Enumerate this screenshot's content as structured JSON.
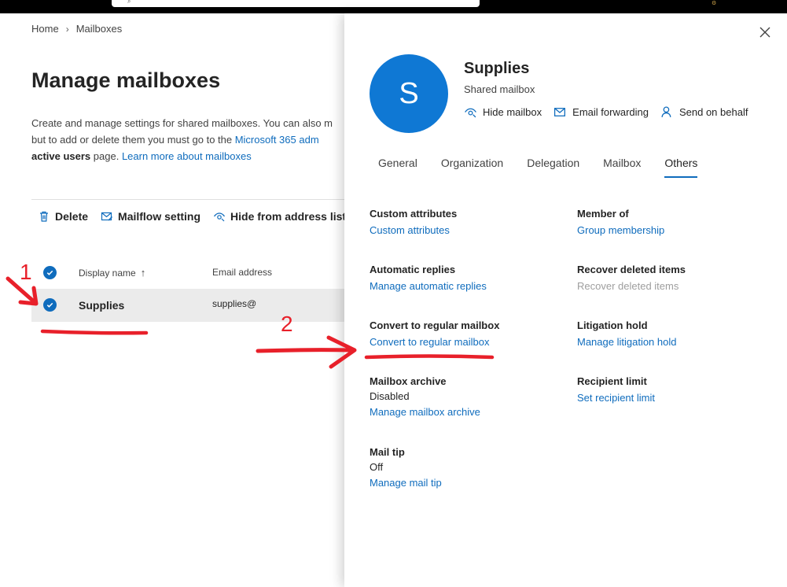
{
  "breadcrumb": {
    "home": "Home",
    "current": "Mailboxes"
  },
  "page": {
    "title": "Manage mailboxes",
    "desc_line1": "Create and manage settings for shared mailboxes. You can also m",
    "desc_line2_prefix": "but to add or delete them you must go to the ",
    "desc_line2_link": "Microsoft 365 adm",
    "desc_line3_bold": "active users",
    "desc_line3_text": " page. ",
    "desc_line3_link": "Learn more about mailboxes"
  },
  "toolbar": {
    "delete": "Delete",
    "mailflow": "Mailflow setting",
    "hide": "Hide from address list"
  },
  "table": {
    "col_name": "Display name",
    "sort_arrow": "↑",
    "col_email": "Email address",
    "rows": [
      {
        "name": "Supplies",
        "email": "supplies@"
      }
    ]
  },
  "panel": {
    "avatar_letter": "S",
    "title": "Supplies",
    "subtitle": "Shared mailbox",
    "actions": {
      "hide": "Hide mailbox",
      "forwarding": "Email forwarding",
      "send_on_behalf": "Send on behalf"
    },
    "tabs": [
      "General",
      "Organization",
      "Delegation",
      "Mailbox",
      "Others"
    ],
    "active_tab": "Others",
    "left": {
      "custom_attr_h": "Custom attributes",
      "custom_attr_link": "Custom attributes",
      "auto_replies_h": "Automatic replies",
      "auto_replies_link": "Manage automatic replies",
      "convert_h": "Convert to regular mailbox",
      "convert_link": "Convert to regular mailbox",
      "archive_h": "Mailbox archive",
      "archive_v": "Disabled",
      "archive_link": "Manage mailbox archive",
      "mailtip_h": "Mail tip",
      "mailtip_v": "Off",
      "mailtip_link": "Manage mail tip"
    },
    "right": {
      "member_h": "Member of",
      "member_link": "Group membership",
      "recover_h": "Recover deleted items",
      "recover_v": "Recover deleted items",
      "litigation_h": "Litigation hold",
      "litigation_link": "Manage litigation hold",
      "recipient_h": "Recipient limit",
      "recipient_link": "Set recipient limit"
    }
  },
  "annotations": {
    "step1": "1",
    "step2": "2",
    "color": "#e8202a"
  }
}
